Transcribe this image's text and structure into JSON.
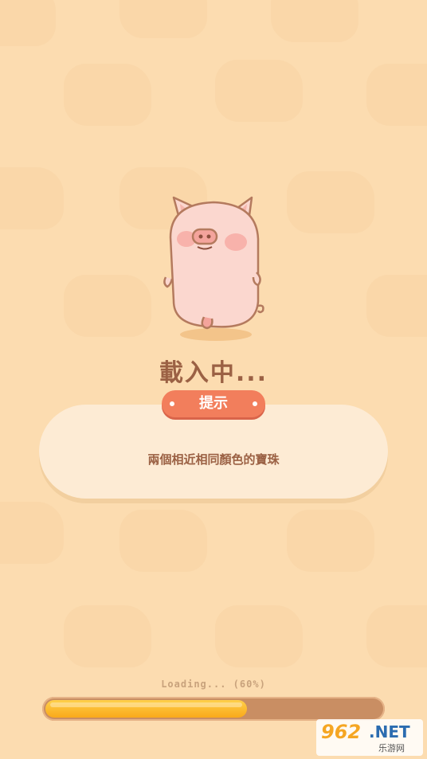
{
  "loading_title": "載入中...",
  "tip": {
    "badge_label": "提示",
    "text": "兩個相近相同顏色的寶珠"
  },
  "progress": {
    "text": "Loading... (60%)",
    "value": 0.6
  },
  "watermark": {
    "number": "962",
    "suffix": ".NET",
    "site": "乐游网"
  },
  "colors": {
    "background": "#fcdcb0",
    "title": "#9b6144",
    "badge": "#f27e5c",
    "progress_fill": "#f9a91a",
    "progress_track": "#c98e63"
  }
}
